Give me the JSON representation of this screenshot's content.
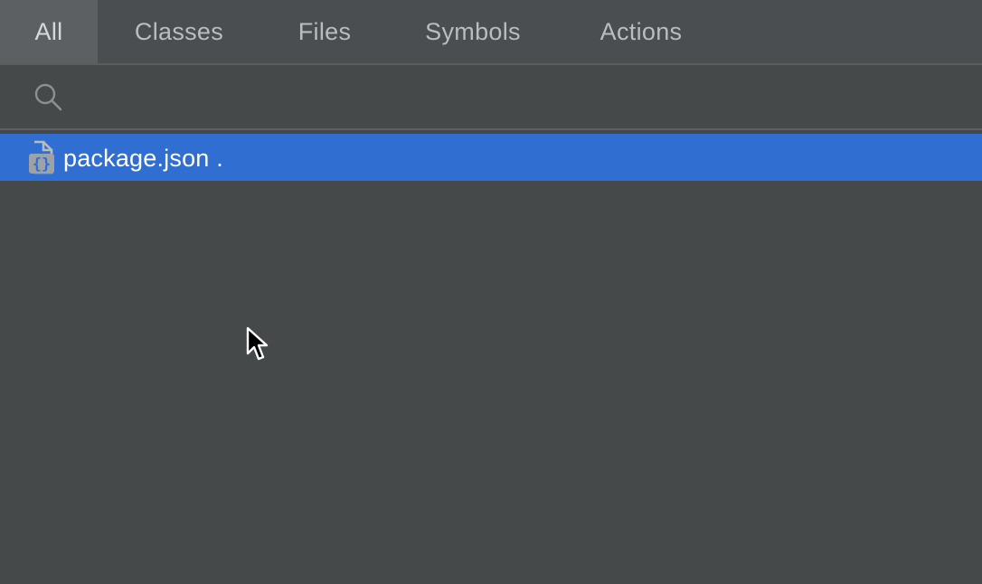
{
  "tabs": [
    {
      "label": "All",
      "active": true
    },
    {
      "label": "Classes",
      "active": false
    },
    {
      "label": "Files",
      "active": false
    },
    {
      "label": "Symbols",
      "active": false
    },
    {
      "label": "Actions",
      "active": false
    }
  ],
  "search": {
    "value": "",
    "icon": "search-icon"
  },
  "results": [
    {
      "label": "package.json .",
      "icon": "json-file-icon",
      "selected": true
    }
  ],
  "colors": {
    "background": "#45494a",
    "tab_bar": "#4b4e50",
    "active_tab": "#5c6063",
    "selection": "#306fd1"
  }
}
